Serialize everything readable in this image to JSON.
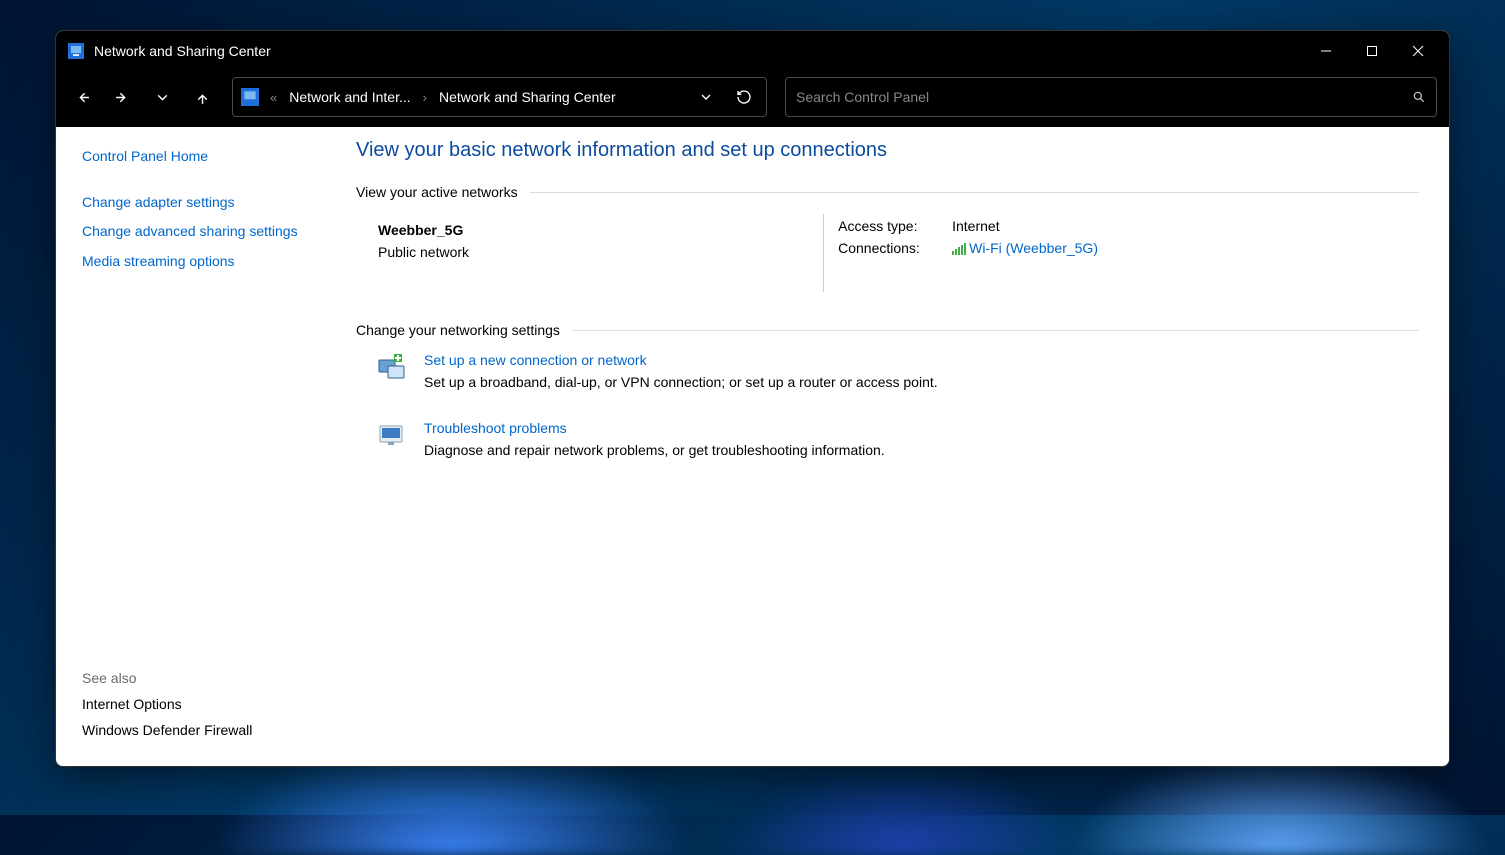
{
  "titlebar": {
    "title": "Network and Sharing Center"
  },
  "breadcrumb": {
    "seg1": "Network and Inter...",
    "seg2": "Network and Sharing Center"
  },
  "search": {
    "placeholder": "Search Control Panel"
  },
  "sidebar": {
    "home": "Control Panel Home",
    "links": {
      "adapter": "Change adapter settings",
      "advanced": "Change advanced sharing settings",
      "media": "Media streaming options"
    },
    "see_also_label": "See also",
    "bottom": {
      "internet_options": "Internet Options",
      "firewall": "Windows Defender Firewall"
    }
  },
  "main": {
    "page_title": "View your basic network information and set up connections",
    "group_active": "View your active networks",
    "network": {
      "name": "Weebber_5G",
      "type": "Public network",
      "access_key": "Access type:",
      "access_val": "Internet",
      "conn_key": "Connections:",
      "conn_val": "Wi-Fi (Weebber_5G)"
    },
    "group_change": "Change your networking settings",
    "task1": {
      "link": "Set up a new connection or network",
      "desc": "Set up a broadband, dial-up, or VPN connection; or set up a router or access point."
    },
    "task2": {
      "link": "Troubleshoot problems",
      "desc": "Diagnose and repair network problems, or get troubleshooting information."
    }
  }
}
